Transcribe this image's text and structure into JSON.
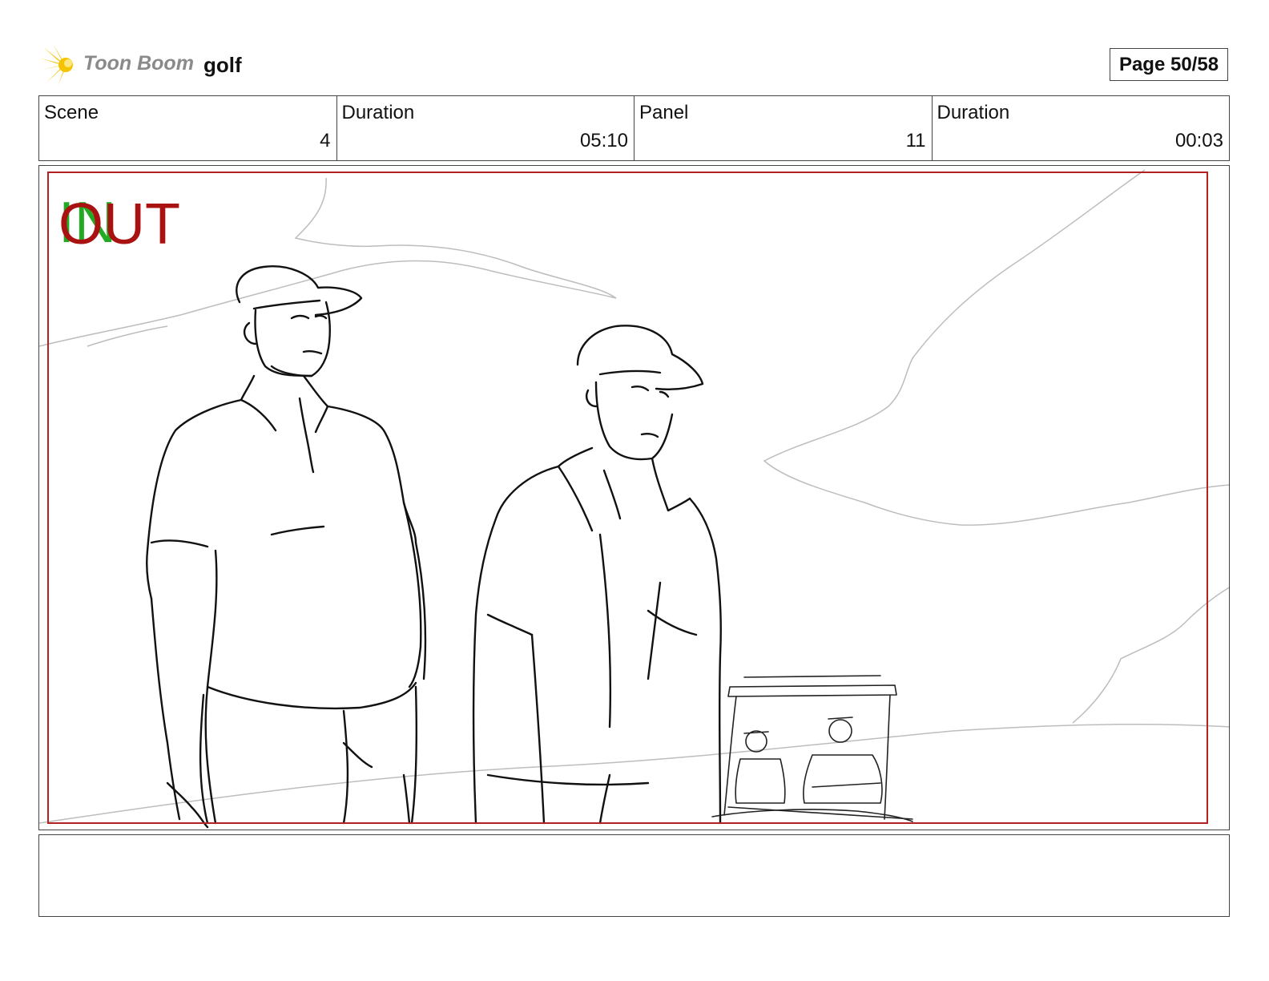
{
  "header": {
    "logo_text": "Toon Boom",
    "project_name": "golf",
    "page_label": "Page 50/58"
  },
  "info": {
    "scene_label": "Scene",
    "scene_value": "4",
    "scene_duration_label": "Duration",
    "scene_duration_value": "05:10",
    "panel_label": "Panel",
    "panel_value": "11",
    "panel_duration_label": "Duration",
    "panel_duration_value": "00:03"
  },
  "panel_marks": {
    "in_label": "IN",
    "out_label": "OUT",
    "in_color": "#22aa22",
    "out_color": "#aa1111",
    "frame_color": "#b22222"
  },
  "notes": {
    "text": ""
  }
}
